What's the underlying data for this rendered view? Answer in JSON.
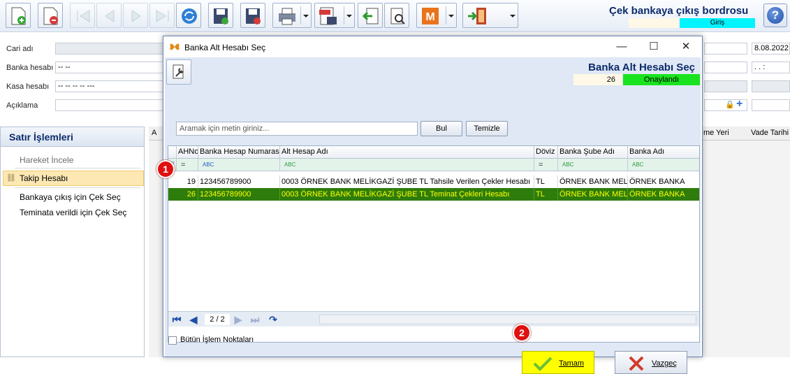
{
  "app": {
    "title": "Çek bankaya çıkış bordrosu",
    "mode": "Giriş",
    "icons": [
      "new-doc-icon",
      "delete-doc-icon",
      "first-record-icon",
      "prev-record-icon",
      "next-record-icon",
      "last-record-icon",
      "refresh-icon",
      "save-icon",
      "save-close-icon",
      "print-icon",
      "pdf-icon",
      "import-icon",
      "tools-icon",
      "m-icon",
      "exit-door-icon",
      "help-icon"
    ]
  },
  "form": {
    "cari_label": "Cari adı",
    "banka_label": "Banka hesabı",
    "banka_value": "-- --",
    "kasa_label": "Kasa hesabı",
    "kasa_value": "-- -- -- -- ---",
    "aciklama_label": "Açıklama",
    "date_value": "8.08.2022",
    "time_value": ". .   :",
    "col_me_yeri": "me Yeri",
    "col_vade": "Vade Tarihi",
    "col_a": "A"
  },
  "side_panel": {
    "title": "Satır İşlemleri",
    "items": [
      "Hareket İncele",
      "Takip Hesabı",
      "Bankaya çıkış için Çek Seç",
      "Teminata verildi için Çek Seç"
    ]
  },
  "dialog": {
    "title": "Banka Alt Hesabı Seç",
    "header_title": "Banka Alt Hesabı Seç",
    "count": "26",
    "status": "Onaylandı",
    "search_placeholder": "Aramak için metin giriniz...",
    "search_button": "Bul",
    "clear_button": "Temizle",
    "columns": [
      "AHNo",
      "Banka Hesap Numarası",
      "Alt Hesap Adı",
      "Döviz",
      "Banka Şube Adı",
      "Banka Adı"
    ],
    "rows": [
      {
        "ahno": "19",
        "hesap_no": "123456789900",
        "alt_hesap": "0003 ÖRNEK BANK MELİKGAZİ ŞUBE TL Tahsile Verilen Çekler Hesabı",
        "doviz": "TL",
        "sube": "ÖRNEK BANK MELİK",
        "banka": "ÖRNEK BANKA"
      },
      {
        "ahno": "26",
        "hesap_no": "123456789900",
        "alt_hesap": "0003 ÖRNEK BANK MELİKGAZİ ŞUBE TL Teminat Çekleri Hesabı",
        "doviz": "TL",
        "sube": "ÖRNEK BANK MELİK",
        "banka": "ÖRNEK BANKA"
      }
    ],
    "page_info": "2 / 2",
    "all_points_label": "Bütün İşlem Noktaları",
    "ok_button": "Tamam",
    "cancel_button": "Vazgeç"
  },
  "annotations": {
    "badge1": "1",
    "badge2": "2"
  },
  "colors": {
    "selected_row": "#2e7d0c",
    "selected_text": "#ffff00",
    "status_green": "#19e31f",
    "mode_cyan": "#00f4ff",
    "badge_red": "#e01010"
  }
}
